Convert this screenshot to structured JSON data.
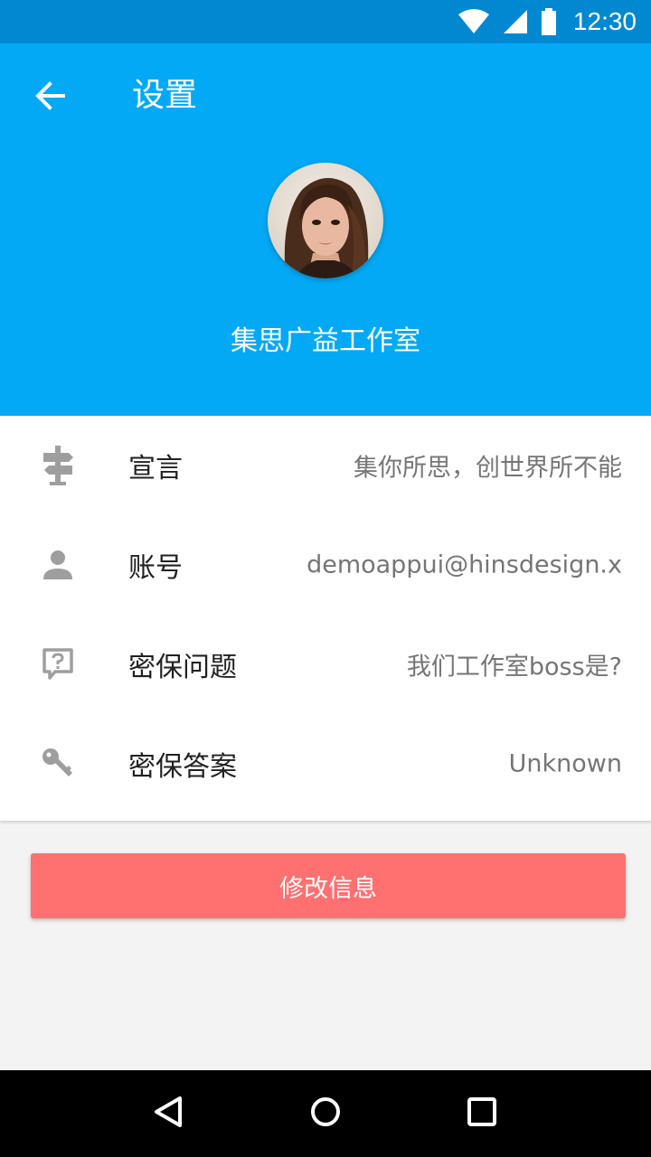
{
  "status_bar": {
    "time": "12:30"
  },
  "header": {
    "title": "设置",
    "profile_name": "集思广益工作室",
    "background_color": "#03a9f4"
  },
  "info_rows": [
    {
      "icon": "signpost-icon",
      "label": "宣言",
      "value": "集你所思，创世界所不能"
    },
    {
      "icon": "person-icon",
      "label": "账号",
      "value": "demoappui@hinsdesign.x"
    },
    {
      "icon": "question-bubble-icon",
      "label": "密保问题",
      "value": "我们工作室boss是?"
    },
    {
      "icon": "key-icon",
      "label": "密保答案",
      "value": "Unknown"
    }
  ],
  "actions": {
    "edit_label": "修改信息",
    "edit_color": "#ff7070"
  },
  "nav_bar": {
    "back_icon": "nav-back-icon",
    "home_icon": "nav-home-icon",
    "recents_icon": "nav-recents-icon"
  }
}
